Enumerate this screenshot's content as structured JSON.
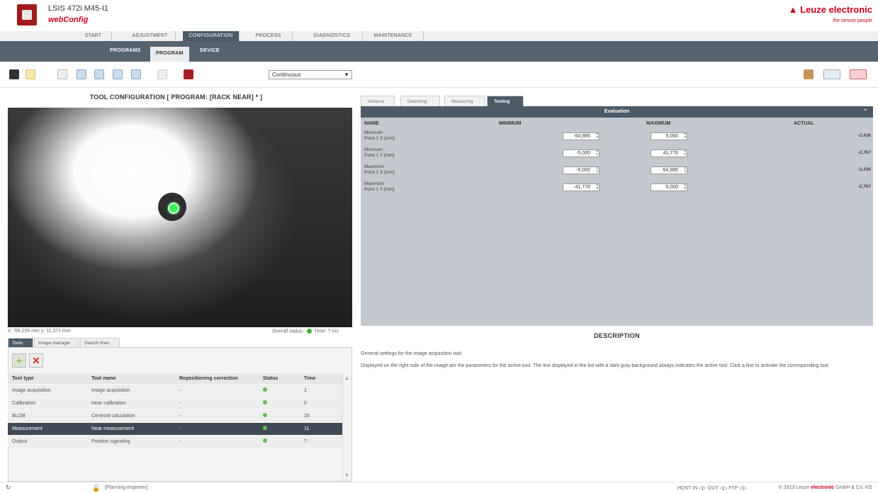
{
  "header": {
    "title": "LSIS 472i M45-I1",
    "subtitle": "webConfig",
    "brand": "Leuze electronic",
    "brand_tagline": "the sensor people"
  },
  "main_nav": [
    "START",
    "ADJUSTMENT",
    "CONFIGURATION",
    "PROCESS",
    "DIAGNOSTICS",
    "MAINTENANCE"
  ],
  "main_nav_active": "CONFIGURATION",
  "sub_nav": [
    "PROGRAMS",
    "PROGRAM",
    "DEVICE"
  ],
  "sub_nav_active": "PROGRAM",
  "toolbar": {
    "mode_select": "Continuous",
    "icons": [
      "camera-icon",
      "play-icon",
      "hand-icon",
      "zoom-in-icon",
      "zoom-out-icon",
      "zoom-fit-icon",
      "zoom-actual-icon",
      "link-icon",
      "settings-icon"
    ]
  },
  "tool_config": {
    "title": "TOOL CONFIGURATION   [ PROGRAM: [RACK NEAR] * ]",
    "coords": "x: -58,155 mm y: 11,371 mm",
    "overall_label": "Overall status:",
    "time_label": "Time: ? ms"
  },
  "lower_tabs": [
    "Tools",
    "Image manager",
    "Search lines"
  ],
  "lower_tab_active": "Tools",
  "tools_table": {
    "headers": [
      "Tool type",
      "Tool name",
      "Repositioning correction",
      "Status",
      "Time"
    ],
    "rows": [
      {
        "type": "Image acquisition",
        "name": "Image acquisition",
        "corr": "-",
        "time": "1"
      },
      {
        "type": "Calibration",
        "name": "Near calibration",
        "corr": "-",
        "time": "0"
      },
      {
        "type": "BLOB",
        "name": "Centroid calculation",
        "corr": "-",
        "time": "26"
      },
      {
        "type": "Measurement",
        "name": "Near measurement",
        "corr": "-",
        "time": "11"
      },
      {
        "type": "Output",
        "name": "Position signaling",
        "corr": "-",
        "time": "?"
      }
    ],
    "selected_index": 3
  },
  "right_tabs": [
    "General",
    "Detecting",
    "Measuring",
    "Testing"
  ],
  "right_tab_active": "Testing",
  "evaluation": {
    "title": "Evaluation",
    "headers": [
      "NAME",
      "MINIMUM",
      "MAXIMUM",
      "ACTUAL"
    ],
    "rows": [
      {
        "name1": "Minimum",
        "name2": "Point 1 X [mm]",
        "min": "-64,985",
        "max": "5,000",
        "actual": "-2,436"
      },
      {
        "name1": "Minimum",
        "name2": "Point 1 Y [mm]",
        "min": "-5,000",
        "max": "41,776",
        "actual": "-2,767"
      },
      {
        "name1": "Maximum",
        "name2": "Point 1 X [mm]",
        "min": "-5,000",
        "max": "64,985",
        "actual": "-2,436"
      },
      {
        "name1": "Maximum",
        "name2": "Point 1 Y [mm]",
        "min": "-41,776",
        "max": "5,000",
        "actual": "-2,767"
      }
    ]
  },
  "description": {
    "title": "DESCRIPTION",
    "line1": "General settings for the image acquisition tool",
    "line2": "Displayed on the right side of the image are the parameters for the active tool. The line displayed in the list with a dark gray background always indicates the active tool. Click a line to activate the corresponding tool."
  },
  "status_bar": {
    "role": "[Planning engineer]",
    "io": "HOST IN ◁▷   OUT ◁▷   FTP ◁▷",
    "copyright_pre": "© 2013 Leuze ",
    "copyright_brand": "electronic",
    "copyright_post": " GmbH & Co. KG"
  },
  "colors": {
    "brand_red": "#c8001e",
    "nav_dark": "#4d5b68",
    "status_green": "#5cc04a"
  }
}
